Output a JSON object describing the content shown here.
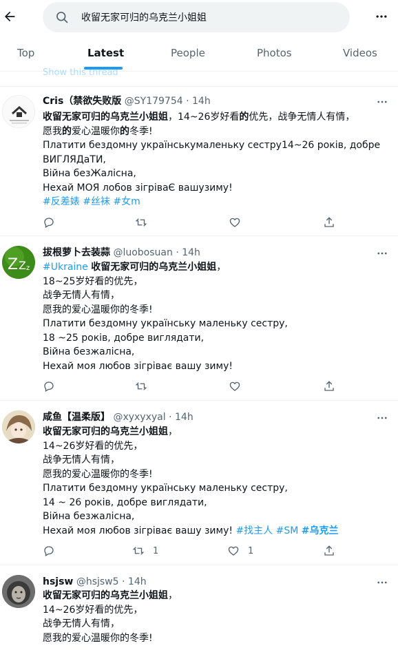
{
  "search": {
    "query": "收留无家可归的乌克兰小姐姐"
  },
  "tabs": [
    {
      "label": "Top"
    },
    {
      "label": "Latest"
    },
    {
      "label": "People"
    },
    {
      "label": "Photos"
    },
    {
      "label": "Videos"
    }
  ],
  "overflow_text": "Show this thread",
  "tweets": [
    {
      "name": "Cris（禁欲失败版",
      "handle": "@SY179754",
      "time": "14h",
      "lines": [
        [
          "收留无家可归的乌克兰小姐姐",
          "，14~26岁好看",
          "的",
          "优先，战争无情人有情，"
        ],
        [
          "愿我",
          "的",
          "爱心温暖你",
          "的",
          "冬季!"
        ],
        "Платити бездомну українськумаленьку сестру14~26 років, добре",
        "ВИГЛЯДаТИ,",
        "Війна безЖалісна,",
        "Нехай МОЯ лобов зігріваЄ вашузиму!"
      ],
      "hashtags": [
        "#反差婊",
        "#丝袜",
        "#女m"
      ],
      "replies": "",
      "retweets": "",
      "likes": ""
    },
    {
      "name": "拔根萝卜去装蒜",
      "handle": "@luobosuan",
      "time": "14h",
      "hashtag_lead": "#Ukraine",
      "lead_bold": "收留无家可归的乌克兰小姐姐",
      "lead_rest": "，",
      "plain_lines": [
        "18~25岁好看",
        "的优先，",
        "战争无情人有情，",
        "愿我的爱心温暖你的冬季!",
        "Платити бездомну українську маленьку сестру,",
        "18 ~25 років, добре виглядати,",
        "Війна безжалісна,",
        "Нехай моя любов зігріває вашу зиму!"
      ],
      "replies": "",
      "retweets": "",
      "likes": ""
    },
    {
      "name": "咸鱼【温柔版】",
      "handle": "@xyxyxyal",
      "time": "14h",
      "lead_bold": "收留无家可归的乌克兰小姐姐",
      "lead_rest": "，",
      "plain_lines": [
        "14~26岁好看的优先，",
        "战争无情人有情，",
        "愿我的爱心温暖你的冬季!",
        "Платити бездомну українську маленьку сестру,",
        "14 ~ 26 років, добре виглядати,",
        "Війна безжалісна,"
      ],
      "last_line": "Нехай моя любов зігріває вашу зиму!",
      "hashtags": [
        "#找主人",
        "#SM",
        "#乌克兰"
      ],
      "replies": "",
      "retweets": "1",
      "likes": "1"
    },
    {
      "name": "hsjsw",
      "handle": "@hsjsw5",
      "time": "14h",
      "lead_bold": "收留无家可归的乌克兰小姐姐",
      "lead_rest": "，",
      "plain_lines": [
        "14~26岁好看的优先，",
        "战争无情人有情，",
        "愿我的爱心温暖你的冬季!"
      ]
    }
  ],
  "colors": {
    "accent": "#1d9bf0",
    "text": "#0f1419",
    "muted": "#536471",
    "divider": "#eff3f4"
  }
}
